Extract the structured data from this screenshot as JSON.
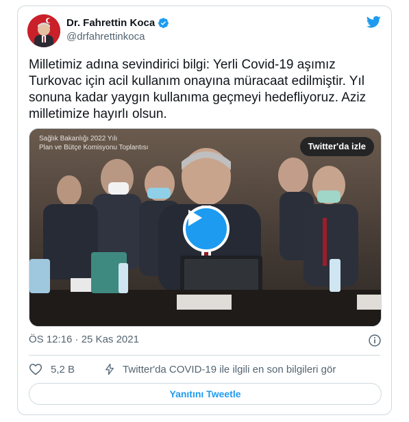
{
  "author": {
    "name": "Dr. Fahrettin Koca",
    "handle": "@drfahrettinkoca"
  },
  "tweet": {
    "text": "Milletimiz adına sevindirici bilgi: Yerli Covid-19 aşımız Turkovac için acil kullanım onayına müracaat edilmiştir. Yıl sonuna kadar yaygın kullanıma geçmeyi hedefliyoruz. Aziz milletimize hayırlı olsun."
  },
  "media": {
    "caption_line1": "Sağlık Bakanlığı 2022 Yılı",
    "caption_line2": "Plan ve Bütçe Komisyonu Toplantısı",
    "watch_label": "Twitter'da izle"
  },
  "meta": {
    "timestamp": "ÖS 12:16 · 25 Kas 2021"
  },
  "actions": {
    "like_count": "5,2 B",
    "covid_info": "Twitter'da COVID-19 ile ilgili en son bilgileri gör",
    "reply_label": "Yanıtını Tweetle"
  },
  "colors": {
    "accent": "#1d9bf0",
    "secondary_text": "#536471",
    "border": "#cfd9de"
  },
  "icons": [
    "verified-badge-icon",
    "twitter-bird-icon",
    "play-icon",
    "info-icon",
    "heart-icon",
    "lightning-icon"
  ]
}
